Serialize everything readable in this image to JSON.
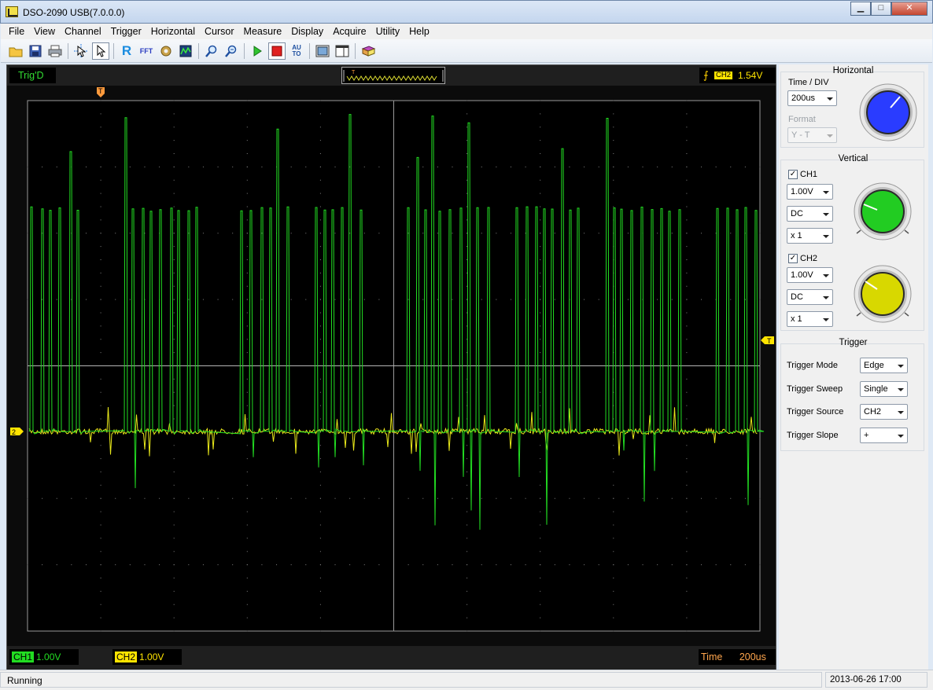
{
  "window": {
    "title": "DSO-2090 USB(7.0.0.0)",
    "minimize_label": "▁",
    "maximize_label": "□",
    "close_label": "✕"
  },
  "menu": [
    "File",
    "View",
    "Channel",
    "Trigger",
    "Horizontal",
    "Cursor",
    "Measure",
    "Display",
    "Acquire",
    "Utility",
    "Help"
  ],
  "toolbar": [
    {
      "icon": "open-folder-icon"
    },
    {
      "icon": "save-icon"
    },
    {
      "icon": "print-icon"
    },
    {
      "icon": "cursor-select-icon"
    },
    {
      "icon": "pointer-icon",
      "active": true
    },
    {
      "icon": "reference-icon",
      "glyph": "R"
    },
    {
      "icon": "fft-icon",
      "glyph": "FFT"
    },
    {
      "icon": "settings-icon"
    },
    {
      "icon": "wave-display-icon"
    },
    {
      "icon": "zoom-in-icon"
    },
    {
      "icon": "zoom-out-icon"
    },
    {
      "icon": "run-icon"
    },
    {
      "icon": "stop-icon",
      "active": true
    },
    {
      "icon": "auto-icon",
      "glyph": "AUTO"
    },
    {
      "icon": "window-icon"
    },
    {
      "icon": "panel-icon"
    },
    {
      "icon": "book-icon"
    }
  ],
  "scope": {
    "trig_state": "Trig'D",
    "trigger_channel_tag": "CH2",
    "trigger_level": "1.54V",
    "trigger_marker": "T",
    "ch2_marker": "2",
    "ch1_tag": "CH1",
    "ch1_scale": "1.00V",
    "ch2_tag": "CH2",
    "ch2_scale": "1.00V",
    "time_label": "Time",
    "time_value": "200us",
    "colors": {
      "ch1": "#22dd22",
      "ch2": "#e8e81a",
      "grid": "#808080",
      "marker": "#ff9a3c"
    }
  },
  "horizontal": {
    "title": "Horizontal",
    "time_div_label": "Time / DIV",
    "time_div_value": "200us",
    "format_label": "Format",
    "format_value": "Y - T",
    "knob_color": "#2a3cff"
  },
  "vertical": {
    "title": "Vertical",
    "ch1": {
      "label": "CH1",
      "checked": true,
      "volts": "1.00V",
      "coupling": "DC",
      "probe": "x 1",
      "knob_color": "#22cc22"
    },
    "ch2": {
      "label": "CH2",
      "checked": true,
      "volts": "1.00V",
      "coupling": "DC",
      "probe": "x 1",
      "knob_color": "#d8d800"
    }
  },
  "trigger": {
    "title": "Trigger",
    "mode_label": "Trigger Mode",
    "mode_value": "Edge",
    "sweep_label": "Trigger Sweep",
    "sweep_value": "Single",
    "source_label": "Trigger Source",
    "source_value": "CH2",
    "slope_label": "Trigger Slope",
    "slope_value": "+"
  },
  "status": {
    "state": "Running",
    "datetime": "2013-06-26  17:00"
  }
}
